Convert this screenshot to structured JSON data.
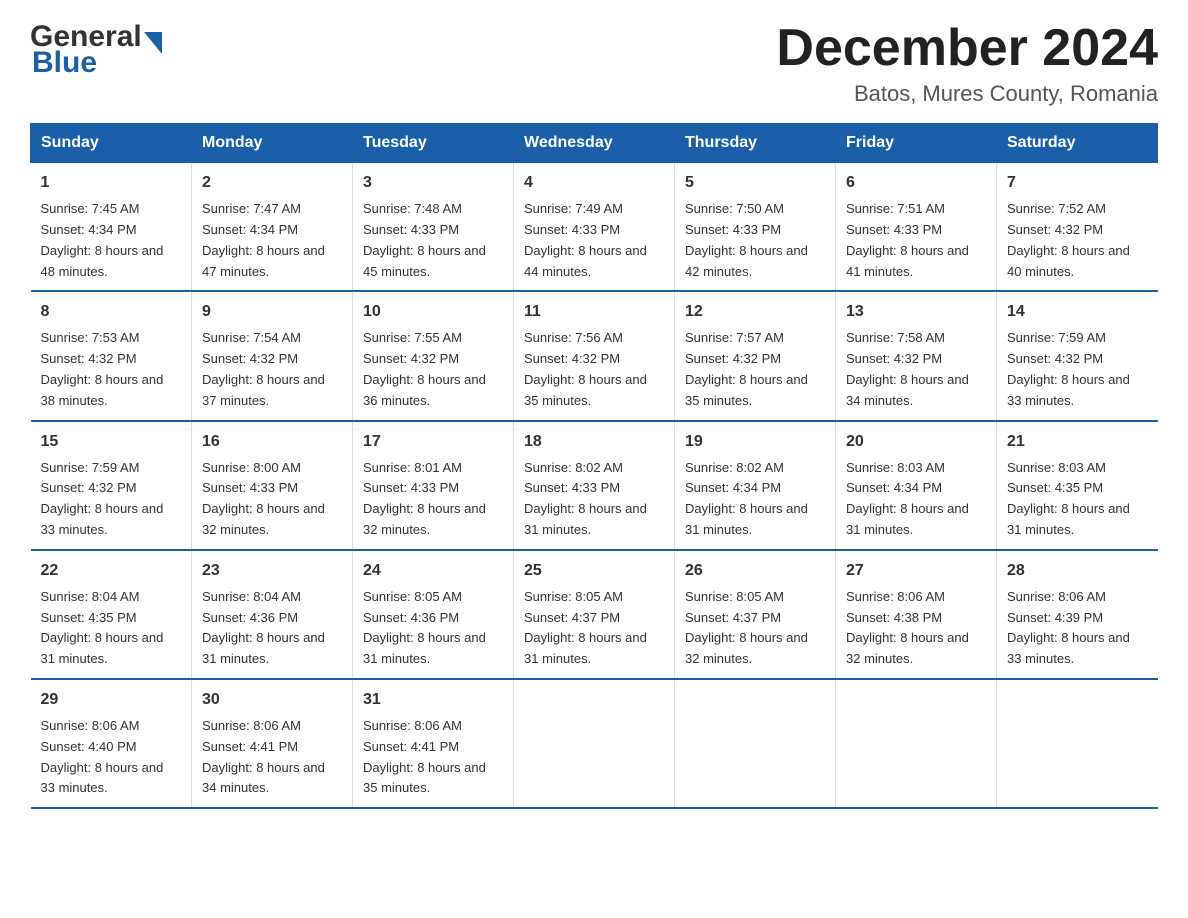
{
  "header": {
    "logo_general": "General",
    "logo_blue": "Blue",
    "month_title": "December 2024",
    "location": "Batos, Mures County, Romania"
  },
  "weekdays": [
    "Sunday",
    "Monday",
    "Tuesday",
    "Wednesday",
    "Thursday",
    "Friday",
    "Saturday"
  ],
  "weeks": [
    [
      {
        "day": "1",
        "sunrise": "Sunrise: 7:45 AM",
        "sunset": "Sunset: 4:34 PM",
        "daylight": "Daylight: 8 hours and 48 minutes."
      },
      {
        "day": "2",
        "sunrise": "Sunrise: 7:47 AM",
        "sunset": "Sunset: 4:34 PM",
        "daylight": "Daylight: 8 hours and 47 minutes."
      },
      {
        "day": "3",
        "sunrise": "Sunrise: 7:48 AM",
        "sunset": "Sunset: 4:33 PM",
        "daylight": "Daylight: 8 hours and 45 minutes."
      },
      {
        "day": "4",
        "sunrise": "Sunrise: 7:49 AM",
        "sunset": "Sunset: 4:33 PM",
        "daylight": "Daylight: 8 hours and 44 minutes."
      },
      {
        "day": "5",
        "sunrise": "Sunrise: 7:50 AM",
        "sunset": "Sunset: 4:33 PM",
        "daylight": "Daylight: 8 hours and 42 minutes."
      },
      {
        "day": "6",
        "sunrise": "Sunrise: 7:51 AM",
        "sunset": "Sunset: 4:33 PM",
        "daylight": "Daylight: 8 hours and 41 minutes."
      },
      {
        "day": "7",
        "sunrise": "Sunrise: 7:52 AM",
        "sunset": "Sunset: 4:32 PM",
        "daylight": "Daylight: 8 hours and 40 minutes."
      }
    ],
    [
      {
        "day": "8",
        "sunrise": "Sunrise: 7:53 AM",
        "sunset": "Sunset: 4:32 PM",
        "daylight": "Daylight: 8 hours and 38 minutes."
      },
      {
        "day": "9",
        "sunrise": "Sunrise: 7:54 AM",
        "sunset": "Sunset: 4:32 PM",
        "daylight": "Daylight: 8 hours and 37 minutes."
      },
      {
        "day": "10",
        "sunrise": "Sunrise: 7:55 AM",
        "sunset": "Sunset: 4:32 PM",
        "daylight": "Daylight: 8 hours and 36 minutes."
      },
      {
        "day": "11",
        "sunrise": "Sunrise: 7:56 AM",
        "sunset": "Sunset: 4:32 PM",
        "daylight": "Daylight: 8 hours and 35 minutes."
      },
      {
        "day": "12",
        "sunrise": "Sunrise: 7:57 AM",
        "sunset": "Sunset: 4:32 PM",
        "daylight": "Daylight: 8 hours and 35 minutes."
      },
      {
        "day": "13",
        "sunrise": "Sunrise: 7:58 AM",
        "sunset": "Sunset: 4:32 PM",
        "daylight": "Daylight: 8 hours and 34 minutes."
      },
      {
        "day": "14",
        "sunrise": "Sunrise: 7:59 AM",
        "sunset": "Sunset: 4:32 PM",
        "daylight": "Daylight: 8 hours and 33 minutes."
      }
    ],
    [
      {
        "day": "15",
        "sunrise": "Sunrise: 7:59 AM",
        "sunset": "Sunset: 4:32 PM",
        "daylight": "Daylight: 8 hours and 33 minutes."
      },
      {
        "day": "16",
        "sunrise": "Sunrise: 8:00 AM",
        "sunset": "Sunset: 4:33 PM",
        "daylight": "Daylight: 8 hours and 32 minutes."
      },
      {
        "day": "17",
        "sunrise": "Sunrise: 8:01 AM",
        "sunset": "Sunset: 4:33 PM",
        "daylight": "Daylight: 8 hours and 32 minutes."
      },
      {
        "day": "18",
        "sunrise": "Sunrise: 8:02 AM",
        "sunset": "Sunset: 4:33 PM",
        "daylight": "Daylight: 8 hours and 31 minutes."
      },
      {
        "day": "19",
        "sunrise": "Sunrise: 8:02 AM",
        "sunset": "Sunset: 4:34 PM",
        "daylight": "Daylight: 8 hours and 31 minutes."
      },
      {
        "day": "20",
        "sunrise": "Sunrise: 8:03 AM",
        "sunset": "Sunset: 4:34 PM",
        "daylight": "Daylight: 8 hours and 31 minutes."
      },
      {
        "day": "21",
        "sunrise": "Sunrise: 8:03 AM",
        "sunset": "Sunset: 4:35 PM",
        "daylight": "Daylight: 8 hours and 31 minutes."
      }
    ],
    [
      {
        "day": "22",
        "sunrise": "Sunrise: 8:04 AM",
        "sunset": "Sunset: 4:35 PM",
        "daylight": "Daylight: 8 hours and 31 minutes."
      },
      {
        "day": "23",
        "sunrise": "Sunrise: 8:04 AM",
        "sunset": "Sunset: 4:36 PM",
        "daylight": "Daylight: 8 hours and 31 minutes."
      },
      {
        "day": "24",
        "sunrise": "Sunrise: 8:05 AM",
        "sunset": "Sunset: 4:36 PM",
        "daylight": "Daylight: 8 hours and 31 minutes."
      },
      {
        "day": "25",
        "sunrise": "Sunrise: 8:05 AM",
        "sunset": "Sunset: 4:37 PM",
        "daylight": "Daylight: 8 hours and 31 minutes."
      },
      {
        "day": "26",
        "sunrise": "Sunrise: 8:05 AM",
        "sunset": "Sunset: 4:37 PM",
        "daylight": "Daylight: 8 hours and 32 minutes."
      },
      {
        "day": "27",
        "sunrise": "Sunrise: 8:06 AM",
        "sunset": "Sunset: 4:38 PM",
        "daylight": "Daylight: 8 hours and 32 minutes."
      },
      {
        "day": "28",
        "sunrise": "Sunrise: 8:06 AM",
        "sunset": "Sunset: 4:39 PM",
        "daylight": "Daylight: 8 hours and 33 minutes."
      }
    ],
    [
      {
        "day": "29",
        "sunrise": "Sunrise: 8:06 AM",
        "sunset": "Sunset: 4:40 PM",
        "daylight": "Daylight: 8 hours and 33 minutes."
      },
      {
        "day": "30",
        "sunrise": "Sunrise: 8:06 AM",
        "sunset": "Sunset: 4:41 PM",
        "daylight": "Daylight: 8 hours and 34 minutes."
      },
      {
        "day": "31",
        "sunrise": "Sunrise: 8:06 AM",
        "sunset": "Sunset: 4:41 PM",
        "daylight": "Daylight: 8 hours and 35 minutes."
      },
      null,
      null,
      null,
      null
    ]
  ]
}
